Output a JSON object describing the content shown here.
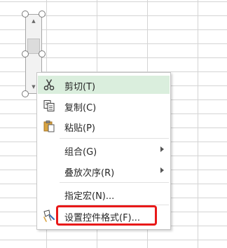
{
  "menu": {
    "items": [
      {
        "label": "剪切(T)",
        "icon": "scissors-icon",
        "has_submenu": false,
        "hover": true
      },
      {
        "label": "复制(C)",
        "icon": "copy-icon",
        "has_submenu": false
      },
      {
        "label": "粘贴(P)",
        "icon": "paste-icon",
        "has_submenu": false
      },
      {
        "label": "组合(G)",
        "icon": "",
        "has_submenu": true
      },
      {
        "label": "叠放次序(R)",
        "icon": "",
        "has_submenu": true
      },
      {
        "label": "指定宏(N)...",
        "icon": "",
        "has_submenu": false
      },
      {
        "label": "设置控件格式(F)...",
        "icon": "format-control-icon",
        "has_submenu": false,
        "highlighted": true
      }
    ]
  },
  "colors": {
    "hover_bg": "#daeedd",
    "highlight_border": "#e81919"
  }
}
